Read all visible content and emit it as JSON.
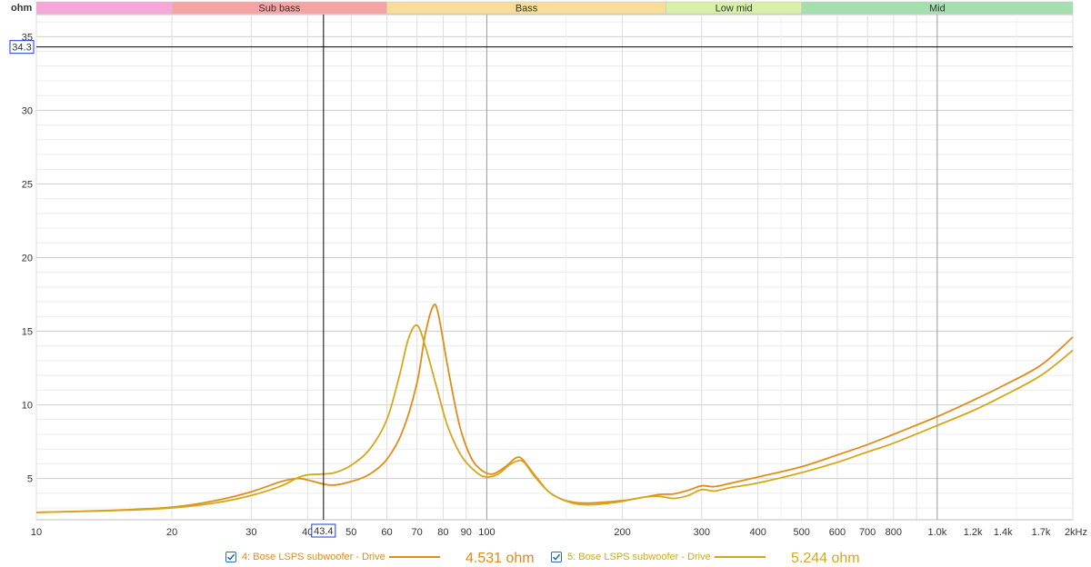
{
  "unit_label": "ohm",
  "cursor": {
    "y_readout": "34.3",
    "x_readout": "43.4",
    "y_value": 34.3,
    "x_value": 43.4
  },
  "bands": [
    {
      "name": "",
      "from": 10,
      "to": 20,
      "color": "#f7a6d8"
    },
    {
      "name": "Sub bass",
      "from": 20,
      "to": 60,
      "color": "#f6a3a3"
    },
    {
      "name": "Bass",
      "from": 60,
      "to": 250,
      "color": "#f8dd9a"
    },
    {
      "name": "Low mid",
      "from": 250,
      "to": 500,
      "color": "#d7efa6"
    },
    {
      "name": "Mid",
      "from": 500,
      "to": 2000,
      "color": "#a4dfae"
    }
  ],
  "legend": [
    {
      "label": "4: Bose LSPS subwoofer - Drive",
      "value": "4.531 ohm",
      "color": "#e08c1a",
      "checked": true
    },
    {
      "label": "5: Bose LSPS subwoofer - Drive",
      "value": "5.244 ohm",
      "color": "#d4a81a",
      "checked": true
    }
  ],
  "chart_data": {
    "type": "line",
    "xscale": "log",
    "xlim": [
      10,
      2000
    ],
    "ylim": [
      2.2,
      36.5
    ],
    "ylabel": "ohm",
    "xunit": "kHz",
    "grid": true,
    "y_ticks": [
      5,
      10,
      15,
      20,
      25,
      30,
      35
    ],
    "y_tick_labels": [
      "5",
      "10",
      "15",
      "20",
      "25",
      "30",
      "35"
    ],
    "x_ticks": [
      {
        "value": 10,
        "label": "10"
      },
      {
        "value": 20,
        "label": "20"
      },
      {
        "value": 30,
        "label": "30"
      },
      {
        "value": 40,
        "label": "40"
      },
      {
        "value": 50,
        "label": "50"
      },
      {
        "value": 60,
        "label": "60"
      },
      {
        "value": 70,
        "label": "70"
      },
      {
        "value": 80,
        "label": "80"
      },
      {
        "value": 90,
        "label": "90"
      },
      {
        "value": 100,
        "label": "100"
      },
      {
        "value": 200,
        "label": "200"
      },
      {
        "value": 300,
        "label": "300"
      },
      {
        "value": 400,
        "label": "400"
      },
      {
        "value": 500,
        "label": "500"
      },
      {
        "value": 600,
        "label": "600"
      },
      {
        "value": 700,
        "label": "700"
      },
      {
        "value": 800,
        "label": "800"
      },
      {
        "value": 1000,
        "label": "1.0k"
      },
      {
        "value": 1200,
        "label": "1.2k"
      },
      {
        "value": 1400,
        "label": "1.4k"
      },
      {
        "value": 1700,
        "label": "1.7k"
      },
      {
        "value": 2000,
        "label": "2kHz"
      }
    ],
    "series": [
      {
        "name": "4: Bose LSPS subwoofer - Drive",
        "color": "#e08c1a",
        "points": [
          [
            10,
            2.7
          ],
          [
            15,
            2.85
          ],
          [
            20,
            3.05
          ],
          [
            25,
            3.5
          ],
          [
            30,
            4.1
          ],
          [
            35,
            4.8
          ],
          [
            38,
            5.0
          ],
          [
            40,
            4.9
          ],
          [
            45,
            4.55
          ],
          [
            50,
            4.8
          ],
          [
            55,
            5.3
          ],
          [
            60,
            6.3
          ],
          [
            65,
            8.2
          ],
          [
            70,
            11.5
          ],
          [
            73,
            14.8
          ],
          [
            76,
            16.7
          ],
          [
            78,
            16.2
          ],
          [
            82,
            12.5
          ],
          [
            87,
            8.6
          ],
          [
            92,
            6.5
          ],
          [
            97,
            5.6
          ],
          [
            103,
            5.3
          ],
          [
            110,
            5.8
          ],
          [
            116,
            6.4
          ],
          [
            120,
            6.3
          ],
          [
            128,
            5.2
          ],
          [
            140,
            3.9
          ],
          [
            160,
            3.35
          ],
          [
            200,
            3.5
          ],
          [
            240,
            3.9
          ],
          [
            260,
            3.95
          ],
          [
            280,
            4.2
          ],
          [
            300,
            4.5
          ],
          [
            320,
            4.45
          ],
          [
            350,
            4.7
          ],
          [
            400,
            5.1
          ],
          [
            500,
            5.8
          ],
          [
            600,
            6.6
          ],
          [
            700,
            7.3
          ],
          [
            800,
            8.0
          ],
          [
            1000,
            9.2
          ],
          [
            1200,
            10.3
          ],
          [
            1400,
            11.3
          ],
          [
            1700,
            12.7
          ],
          [
            2000,
            14.6
          ]
        ]
      },
      {
        "name": "5: Bose LSPS subwoofer - Drive",
        "color": "#d4a81a",
        "points": [
          [
            10,
            2.7
          ],
          [
            15,
            2.82
          ],
          [
            20,
            3.0
          ],
          [
            25,
            3.35
          ],
          [
            30,
            3.85
          ],
          [
            35,
            4.5
          ],
          [
            38,
            5.05
          ],
          [
            40,
            5.25
          ],
          [
            43,
            5.3
          ],
          [
            46,
            5.4
          ],
          [
            50,
            5.9
          ],
          [
            55,
            7.0
          ],
          [
            60,
            9.0
          ],
          [
            64,
            12.0
          ],
          [
            67,
            14.5
          ],
          [
            70,
            15.4
          ],
          [
            73,
            14.0
          ],
          [
            78,
            10.8
          ],
          [
            82,
            8.5
          ],
          [
            88,
            6.5
          ],
          [
            95,
            5.4
          ],
          [
            100,
            5.1
          ],
          [
            106,
            5.3
          ],
          [
            112,
            5.9
          ],
          [
            117,
            6.2
          ],
          [
            121,
            6.1
          ],
          [
            128,
            5.1
          ],
          [
            140,
            3.9
          ],
          [
            160,
            3.25
          ],
          [
            190,
            3.35
          ],
          [
            220,
            3.7
          ],
          [
            240,
            3.8
          ],
          [
            260,
            3.65
          ],
          [
            280,
            3.85
          ],
          [
            300,
            4.25
          ],
          [
            320,
            4.15
          ],
          [
            350,
            4.4
          ],
          [
            400,
            4.7
          ],
          [
            500,
            5.4
          ],
          [
            600,
            6.1
          ],
          [
            700,
            6.8
          ],
          [
            800,
            7.4
          ],
          [
            1000,
            8.6
          ],
          [
            1200,
            9.6
          ],
          [
            1400,
            10.6
          ],
          [
            1700,
            12.0
          ],
          [
            2000,
            13.7
          ]
        ]
      }
    ]
  }
}
